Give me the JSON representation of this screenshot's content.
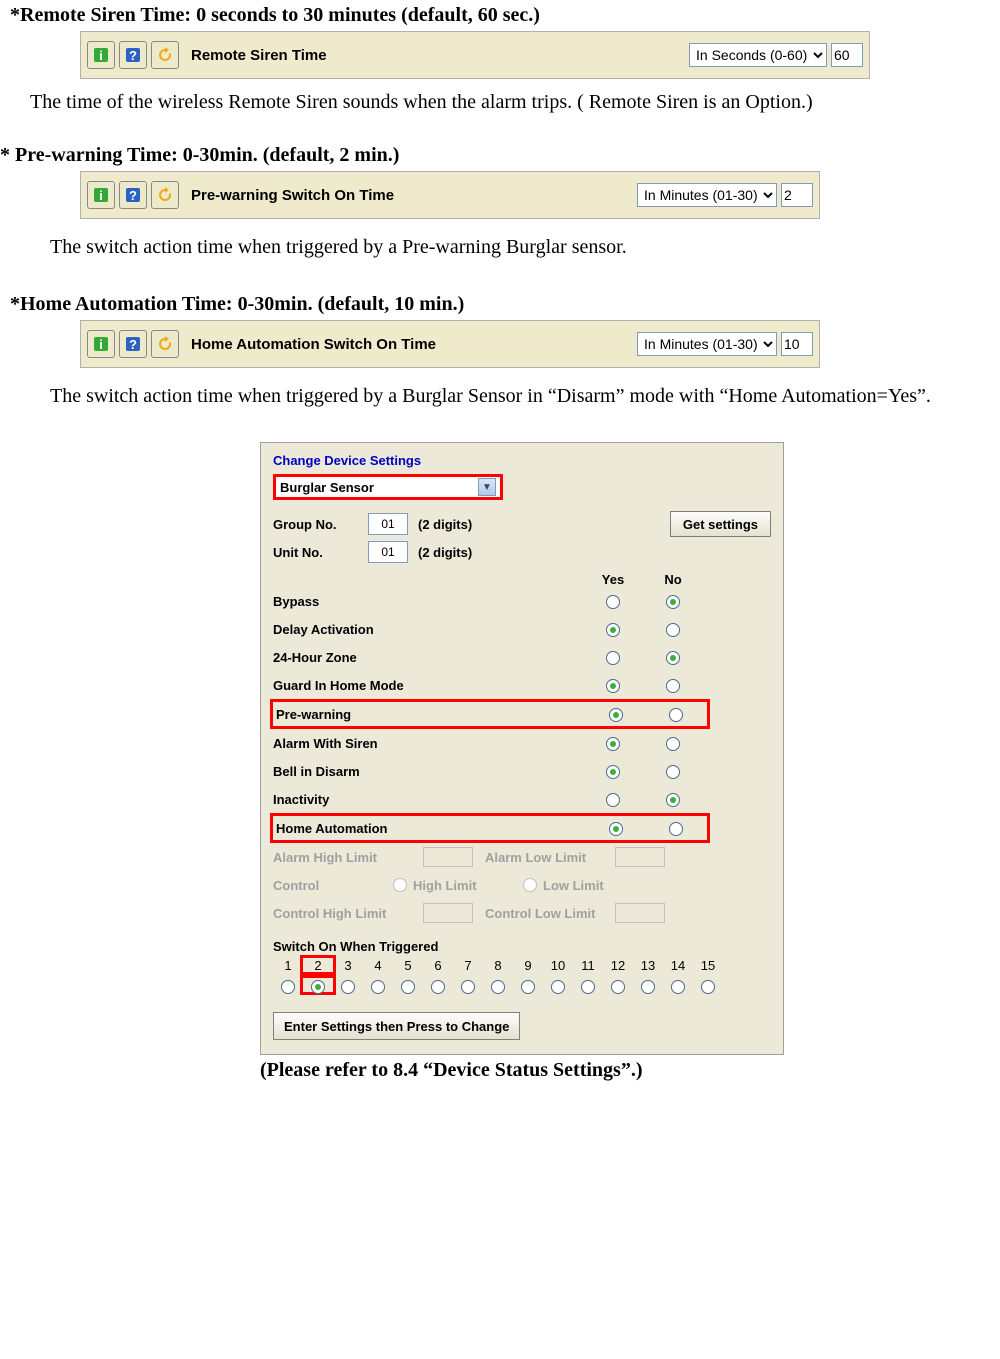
{
  "sections": {
    "remote": {
      "heading": "*Remote Siren Time: 0 seconds to 30 minutes (default, 60 sec.)",
      "label": "Remote Siren Time",
      "unit_option": "In Seconds (0-60)",
      "value": "60",
      "desc": "The time of the wireless Remote Siren sounds when the alarm trips. ( Remote Siren is an Option.)"
    },
    "prewarn": {
      "heading": "* Pre-warning Time: 0-30min.    (default, 2 min.)",
      "label": "Pre-warning Switch On Time",
      "unit_option": "In Minutes (01-30)",
      "value": "2",
      "desc": "The switch action time when triggered by a Pre-warning Burglar sensor."
    },
    "homeauto": {
      "heading": "*Home Automation Time: 0-30min.    (default, 10 min.)",
      "label": "Home Automation Switch On Time",
      "unit_option": "In Minutes (01-30)",
      "value": "10",
      "desc": "The switch action time when triggered by a Burglar Sensor in “Disarm” mode with “Home Automation=Yes”."
    }
  },
  "panel": {
    "title": "Change Device Settings",
    "type": "Burglar Sensor",
    "group_label": "Group No.",
    "group_value": "01",
    "unit_label": "Unit No.",
    "unit_value": "01",
    "digits_hint": "(2 digits)",
    "get_btn": "Get settings",
    "yes": "Yes",
    "no": "No",
    "options": [
      {
        "label": "Bypass",
        "yes": false,
        "no": true,
        "highlight": false
      },
      {
        "label": "Delay Activation",
        "yes": true,
        "no": false,
        "highlight": false
      },
      {
        "label": "24-Hour Zone",
        "yes": false,
        "no": true,
        "highlight": false
      },
      {
        "label": "Guard In Home Mode",
        "yes": true,
        "no": false,
        "highlight": false
      },
      {
        "label": "Pre-warning",
        "yes": true,
        "no": false,
        "highlight": true
      },
      {
        "label": "Alarm With Siren",
        "yes": true,
        "no": false,
        "highlight": false
      },
      {
        "label": "Bell in Disarm",
        "yes": true,
        "no": false,
        "highlight": false
      },
      {
        "label": "Inactivity",
        "yes": false,
        "no": true,
        "highlight": false
      },
      {
        "label": "Home Automation",
        "yes": true,
        "no": false,
        "highlight": true
      }
    ],
    "alarm_high": "Alarm High Limit",
    "alarm_low": "Alarm Low Limit",
    "control": "Control",
    "high_limit": "High Limit",
    "low_limit": "Low Limit",
    "ctrl_high": "Control High Limit",
    "ctrl_low": "Control Low Limit",
    "switch_title": "Switch On When Triggered",
    "switch_numbers": [
      "1",
      "2",
      "3",
      "4",
      "5",
      "6",
      "7",
      "8",
      "9",
      "10",
      "11",
      "12",
      "13",
      "14",
      "15"
    ],
    "switch_selected_index": 1,
    "enter_btn": "Enter Settings then Press to Change"
  },
  "caption": "(Please refer to 8.4 “Device Status Settings”.)"
}
